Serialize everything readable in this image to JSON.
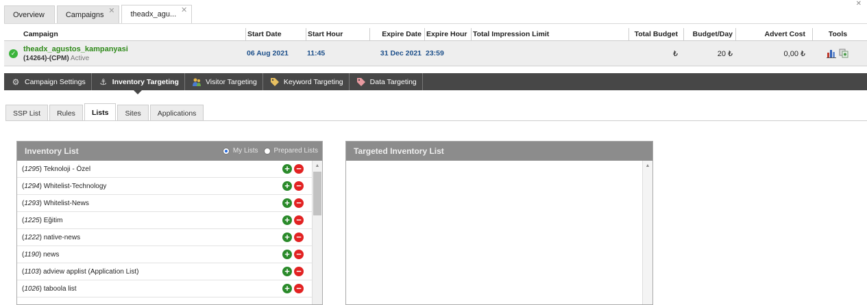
{
  "top_close": "✕",
  "top_tabs": [
    {
      "label": "Overview"
    },
    {
      "label": "Campaigns",
      "close": "✕"
    },
    {
      "label": "theadx_agu...",
      "close": "✕"
    }
  ],
  "table": {
    "headers": {
      "campaign": "Campaign",
      "start_date": "Start Date",
      "start_hour": "Start Hour",
      "expire_date": "Expire Date",
      "expire_hour": "Expire Hour",
      "total_impression_limit": "Total Impression Limit",
      "total_budget": "Total Budget",
      "budget_day": "Budget/Day",
      "advert_cost": "Advert Cost",
      "tools": "Tools"
    },
    "row": {
      "name": "theadx_agustos_kampanyasi",
      "id_type": "(14264)-(CPM)",
      "status": "Active",
      "start_date": "06 Aug 2021",
      "start_hour": "11:45",
      "expire_date": "31 Dec 2021",
      "expire_hour": "23:59",
      "total_impression_limit": "",
      "total_budget": "₺",
      "budget_day": "20 ₺",
      "advert_cost": "0,00 ₺"
    }
  },
  "nav": {
    "items": [
      {
        "label": "Campaign Settings",
        "icon": "gear-icon"
      },
      {
        "label": "Inventory Targeting",
        "icon": "anchor-icon"
      },
      {
        "label": "Visitor Targeting",
        "icon": "users-icon"
      },
      {
        "label": "Keyword Targeting",
        "icon": "tag-icon"
      },
      {
        "label": "Data Targeting",
        "icon": "tag-icon"
      }
    ]
  },
  "sub_tabs": [
    "SSP List",
    "Rules",
    "Lists",
    "Sites",
    "Applications"
  ],
  "inventory": {
    "title": "Inventory List",
    "radio_my": "My Lists",
    "radio_prepared": "Prepared Lists",
    "items": [
      {
        "id": "1295",
        "name": "Teknoloji - Özel"
      },
      {
        "id": "1294",
        "name": "Whitelist-Technology"
      },
      {
        "id": "1293",
        "name": "Whitelist-News"
      },
      {
        "id": "1225",
        "name": "Eğitim"
      },
      {
        "id": "1222",
        "name": "native-news"
      },
      {
        "id": "1190",
        "name": "news"
      },
      {
        "id": "1103",
        "name": "adview applist (Application List)"
      },
      {
        "id": "1026",
        "name": "taboola list"
      }
    ]
  },
  "targeted": {
    "title": "Targeted Inventory List"
  },
  "colors": {
    "nav_bg": "#474747",
    "panel_head": "#8c8c8c",
    "campaign_green": "#2f8a1a",
    "date_blue": "#1c4f8a",
    "add_green": "#2a8a2a",
    "remove_red": "#e22222"
  }
}
